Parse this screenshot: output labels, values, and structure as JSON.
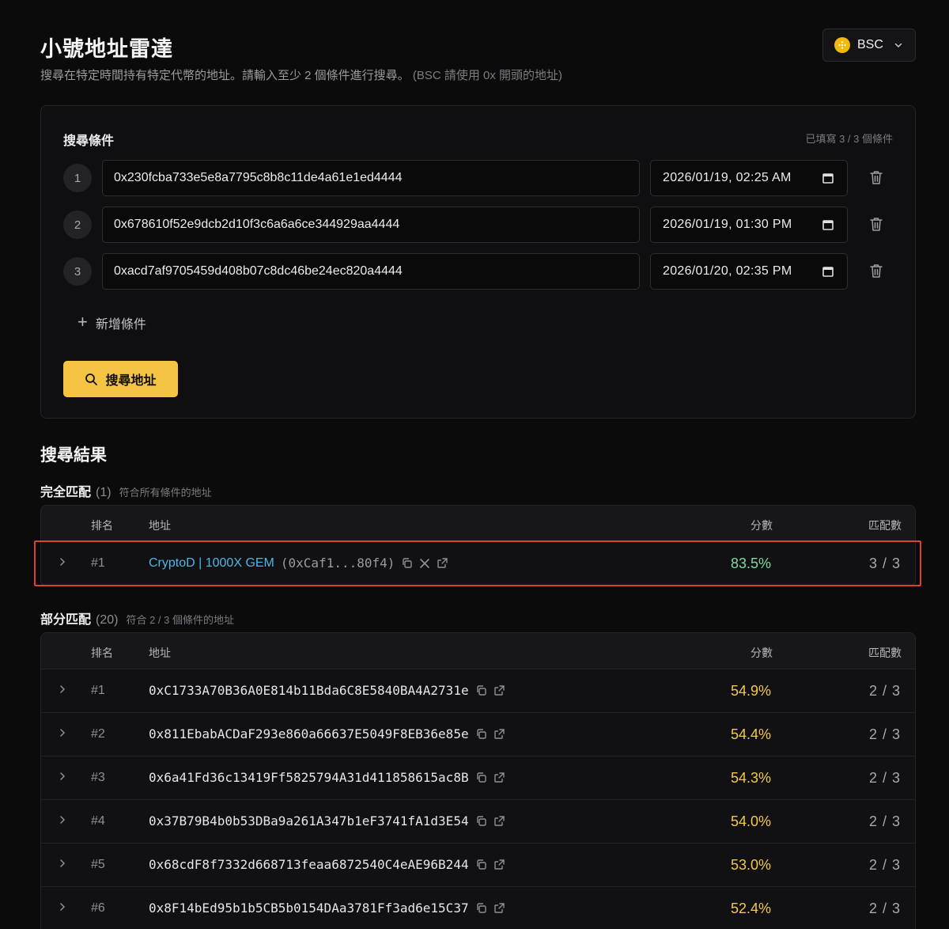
{
  "header": {
    "title": "小號地址雷達",
    "subtitle": "搜尋在特定時間持有特定代幣的地址。請輸入至少 2 個條件進行搜尋。",
    "subtitle_hint": "(BSC 請使用 0x 開頭的地址)",
    "chain_label": "BSC"
  },
  "search": {
    "title": "搜尋條件",
    "filled_count": "已填寫 3 / 3 個條件",
    "conditions": [
      {
        "num": "1",
        "address": "0x230fcba733e5e8a7795c8b8c11de4a61e1ed4444",
        "datetime": "2026/01/19, 02:25 AM"
      },
      {
        "num": "2",
        "address": "0x678610f52e9dcb2d10f3c6a6a6ce344929aa4444",
        "datetime": "2026/01/19, 01:30 PM"
      },
      {
        "num": "3",
        "address": "0xacd7af9705459d408b07c8dc46be24ec820a4444",
        "datetime": "2026/01/20, 02:35 PM"
      }
    ],
    "add_label": "新增條件",
    "search_button": "搜尋地址"
  },
  "results": {
    "title": "搜尋結果",
    "full": {
      "label": "完全匹配",
      "count": "(1)",
      "desc": "符合所有條件的地址",
      "columns": {
        "rank": "排名",
        "address": "地址",
        "score": "分數",
        "match": "匹配數"
      },
      "rows": [
        {
          "rank": "#1",
          "name": "CryptoD | 1000X GEM",
          "short": "(0xCaf1...80f4)",
          "score": "83.5%",
          "match": "3 / 3"
        }
      ]
    },
    "partial": {
      "label": "部分匹配",
      "count": "(20)",
      "desc": "符合 2 / 3 個條件的地址",
      "columns": {
        "rank": "排名",
        "address": "地址",
        "score": "分數",
        "match": "匹配數"
      },
      "rows": [
        {
          "rank": "#1",
          "address": "0xC1733A70B36A0E814b11Bda6C8E5840BA4A2731e",
          "score": "54.9%",
          "match": "2 / 3"
        },
        {
          "rank": "#2",
          "address": "0x811EbabACDaF293e860a66637E5049F8EB36e85e",
          "score": "54.4%",
          "match": "2 / 3"
        },
        {
          "rank": "#3",
          "address": "0x6a41Fd36c13419Ff5825794A31d411858615ac8B",
          "score": "54.3%",
          "match": "2 / 3"
        },
        {
          "rank": "#4",
          "address": "0x37B79B4b0b53DBa9a261A347b1eF3741fA1d3E54",
          "score": "54.0%",
          "match": "2 / 3"
        },
        {
          "rank": "#5",
          "address": "0x68cdF8f7332d668713feaa6872540C4eAE96B244",
          "score": "53.0%",
          "match": "2 / 3"
        },
        {
          "rank": "#6",
          "address": "0x8F14bEd95b1b5CB5b0154DAa3781Ff3ad6e15C37",
          "score": "52.4%",
          "match": "2 / 3"
        }
      ]
    }
  },
  "colors": {
    "accent": "#f5c443",
    "score_full": "#7fd9a0",
    "score_partial": "#f3c84a",
    "link": "#4fb6e8",
    "highlight": "#e0402e"
  }
}
